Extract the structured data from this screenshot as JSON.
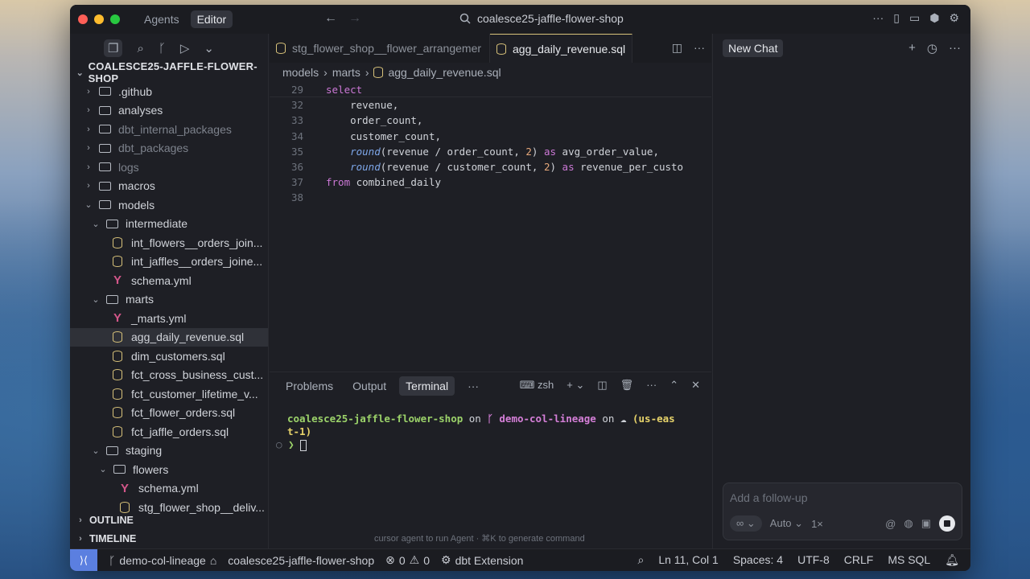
{
  "titlebar": {
    "tab_agents": "Agents",
    "tab_editor": "Editor",
    "search_title": "coalesce25-jaffle-flower-shop"
  },
  "sidebar": {
    "project": "COALESCE25-JAFFLE-FLOWER-SHOP",
    "items": [
      {
        "label": ".github",
        "depth": 0,
        "kind": "folder",
        "chev": "›",
        "dim": false
      },
      {
        "label": "analyses",
        "depth": 0,
        "kind": "folder",
        "chev": "›",
        "dim": false
      },
      {
        "label": "dbt_internal_packages",
        "depth": 0,
        "kind": "folder",
        "chev": "›",
        "dim": true
      },
      {
        "label": "dbt_packages",
        "depth": 0,
        "kind": "folder",
        "chev": "›",
        "dim": true
      },
      {
        "label": "logs",
        "depth": 0,
        "kind": "folder",
        "chev": "›",
        "dim": true
      },
      {
        "label": "macros",
        "depth": 0,
        "kind": "folder",
        "chev": "›",
        "dim": false
      },
      {
        "label": "models",
        "depth": 0,
        "kind": "folder",
        "chev": "⌄",
        "dim": false
      },
      {
        "label": "intermediate",
        "depth": 1,
        "kind": "folder",
        "chev": "⌄",
        "dim": false
      },
      {
        "label": "int_flowers__orders_join...",
        "depth": 2,
        "kind": "sql",
        "chev": "",
        "dim": false
      },
      {
        "label": "int_jaffles__orders_joine...",
        "depth": 2,
        "kind": "sql",
        "chev": "",
        "dim": false
      },
      {
        "label": "schema.yml",
        "depth": 2,
        "kind": "yml",
        "chev": "",
        "dim": false
      },
      {
        "label": "marts",
        "depth": 1,
        "kind": "folder",
        "chev": "⌄",
        "dim": false
      },
      {
        "label": "_marts.yml",
        "depth": 2,
        "kind": "yml",
        "chev": "",
        "dim": false
      },
      {
        "label": "agg_daily_revenue.sql",
        "depth": 2,
        "kind": "sql",
        "chev": "",
        "dim": false,
        "selected": true
      },
      {
        "label": "dim_customers.sql",
        "depth": 2,
        "kind": "sql",
        "chev": "",
        "dim": false
      },
      {
        "label": "fct_cross_business_cust...",
        "depth": 2,
        "kind": "sql",
        "chev": "",
        "dim": false
      },
      {
        "label": "fct_customer_lifetime_v...",
        "depth": 2,
        "kind": "sql",
        "chev": "",
        "dim": false
      },
      {
        "label": "fct_flower_orders.sql",
        "depth": 2,
        "kind": "sql",
        "chev": "",
        "dim": false
      },
      {
        "label": "fct_jaffle_orders.sql",
        "depth": 2,
        "kind": "sql",
        "chev": "",
        "dim": false
      },
      {
        "label": "staging",
        "depth": 1,
        "kind": "folder",
        "chev": "⌄",
        "dim": false
      },
      {
        "label": "flowers",
        "depth": 2,
        "kind": "folder",
        "chev": "⌄",
        "dim": false
      },
      {
        "label": "schema.yml",
        "depth": 3,
        "kind": "yml",
        "chev": "",
        "dim": false
      },
      {
        "label": "stg_flower_shop__deliv...",
        "depth": 3,
        "kind": "sql",
        "chev": "",
        "dim": false
      }
    ],
    "outline": "OUTLINE",
    "timeline": "TIMELINE"
  },
  "editor": {
    "tabs": [
      {
        "label": "stg_flower_shop__flower_arrangemer",
        "active": false
      },
      {
        "label": "agg_daily_revenue.sql",
        "active": true
      }
    ],
    "breadcrumb": [
      "models",
      "marts",
      "agg_daily_revenue.sql"
    ],
    "lines": [
      {
        "n": "29",
        "tokens": [
          {
            "t": "select",
            "c": "kw"
          }
        ],
        "indent": ""
      },
      {
        "n": "32",
        "tokens": [
          {
            "t": "revenue,",
            "c": ""
          }
        ],
        "indent": "    "
      },
      {
        "n": "33",
        "tokens": [
          {
            "t": "order_count,",
            "c": ""
          }
        ],
        "indent": "    "
      },
      {
        "n": "34",
        "tokens": [
          {
            "t": "customer_count,",
            "c": ""
          }
        ],
        "indent": "    "
      },
      {
        "n": "35",
        "tokens": [
          {
            "t": "round",
            "c": "fn"
          },
          {
            "t": "(revenue / order_count, ",
            "c": ""
          },
          {
            "t": "2",
            "c": "num"
          },
          {
            "t": ") ",
            "c": ""
          },
          {
            "t": "as",
            "c": "kw"
          },
          {
            "t": " avg_order_value,",
            "c": ""
          }
        ],
        "indent": "    "
      },
      {
        "n": "36",
        "tokens": [
          {
            "t": "round",
            "c": "fn"
          },
          {
            "t": "(revenue / customer_count, ",
            "c": ""
          },
          {
            "t": "2",
            "c": "num"
          },
          {
            "t": ") ",
            "c": ""
          },
          {
            "t": "as",
            "c": "kw"
          },
          {
            "t": " revenue_per_custo",
            "c": ""
          }
        ],
        "indent": "    "
      },
      {
        "n": "37",
        "tokens": [
          {
            "t": "from",
            "c": "kw"
          },
          {
            "t": " combined_daily",
            "c": ""
          }
        ],
        "indent": ""
      },
      {
        "n": "38",
        "tokens": [],
        "indent": ""
      }
    ]
  },
  "panel": {
    "tabs": [
      "Problems",
      "Output",
      "Terminal"
    ],
    "active_tab": "Terminal",
    "more": "···",
    "shell": "zsh",
    "term_dir": "coalesce25-jaffle-flower-shop",
    "term_on1": " on ",
    "term_branch_icon": "ᚴ",
    "term_branch": "demo-col-lineage",
    "term_on2": " on ",
    "term_cloud": "☁",
    "term_region_a": " (us-eas",
    "term_region_b": "t-1)",
    "prompt": "❯",
    "hint": "cursor agent to run Agent · ⌘K to generate command"
  },
  "chat": {
    "new_chat": "New Chat",
    "placeholder": "Add a follow-up",
    "mode": "∞",
    "model": "Auto",
    "multiplier": "1×"
  },
  "status": {
    "branch": "demo-col-lineage",
    "project": "coalesce25-jaffle-flower-shop",
    "errors": "0",
    "warnings": "0",
    "extension": "dbt Extension",
    "position": "Ln 11, Col 1",
    "spaces": "Spaces: 4",
    "encoding": "UTF-8",
    "eol": "CRLF",
    "language": "MS SQL"
  }
}
